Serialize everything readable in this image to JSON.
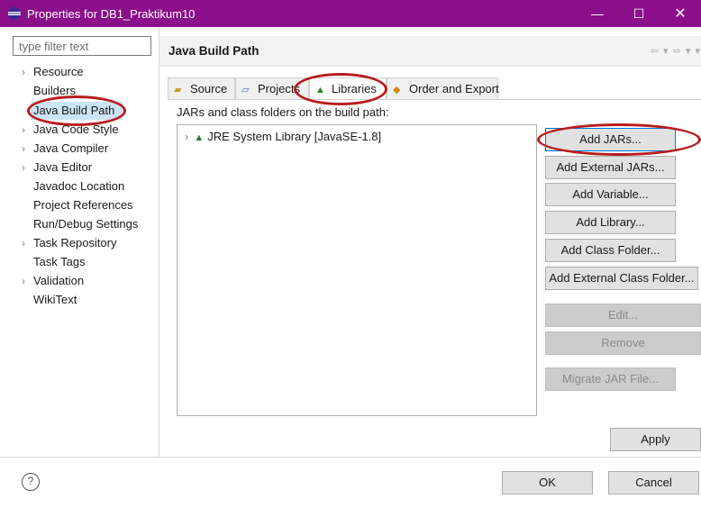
{
  "window": {
    "title": "Properties for DB1_Praktikum10",
    "minimize_glyph": "—",
    "maximize_glyph": "☐",
    "close_glyph": "✕",
    "accent_color": "#8b0e8b"
  },
  "filter": {
    "placeholder": "type filter text"
  },
  "tree": {
    "expand_glyph": "›",
    "items": [
      {
        "label": "Resource",
        "expandable": true
      },
      {
        "label": "Builders",
        "expandable": false
      },
      {
        "label": "Java Build Path",
        "expandable": false,
        "selected": true
      },
      {
        "label": "Java Code Style",
        "expandable": true
      },
      {
        "label": "Java Compiler",
        "expandable": true
      },
      {
        "label": "Java Editor",
        "expandable": true
      },
      {
        "label": "Javadoc Location",
        "expandable": false
      },
      {
        "label": "Project References",
        "expandable": false
      },
      {
        "label": "Run/Debug Settings",
        "expandable": false
      },
      {
        "label": "Task Repository",
        "expandable": true
      },
      {
        "label": "Task Tags",
        "expandable": false
      },
      {
        "label": "Validation",
        "expandable": true
      },
      {
        "label": "WikiText",
        "expandable": false
      }
    ]
  },
  "page": {
    "title": "Java Build Path",
    "nav_icons": "⇦ ▾ ⇨ ▾ ▾"
  },
  "tabs": [
    {
      "label": "Source",
      "icon": "source-folder-icon"
    },
    {
      "label": "Projects",
      "icon": "project-folder-icon"
    },
    {
      "label": "Libraries",
      "icon": "library-icon",
      "active": true
    },
    {
      "label": "Order and Export",
      "icon": "order-export-icon"
    }
  ],
  "libraries": {
    "section_label": "JARs and class folders on the build path:",
    "entries": [
      {
        "label": "JRE System Library [JavaSE-1.8]",
        "expand_glyph": "›"
      }
    ]
  },
  "buttons": {
    "add_jars": "Add JARs...",
    "add_external_jars": "Add External JARs...",
    "add_variable": "Add Variable...",
    "add_library": "Add Library...",
    "add_class_folder": "Add Class Folder...",
    "add_external_class_folder": "Add External Class Folder...",
    "edit": "Edit...",
    "remove": "Remove",
    "migrate_jar": "Migrate JAR File...",
    "apply": "Apply",
    "ok": "OK",
    "cancel": "Cancel"
  },
  "help": {
    "glyph": "?"
  },
  "annotation_color": "#b81c1c"
}
